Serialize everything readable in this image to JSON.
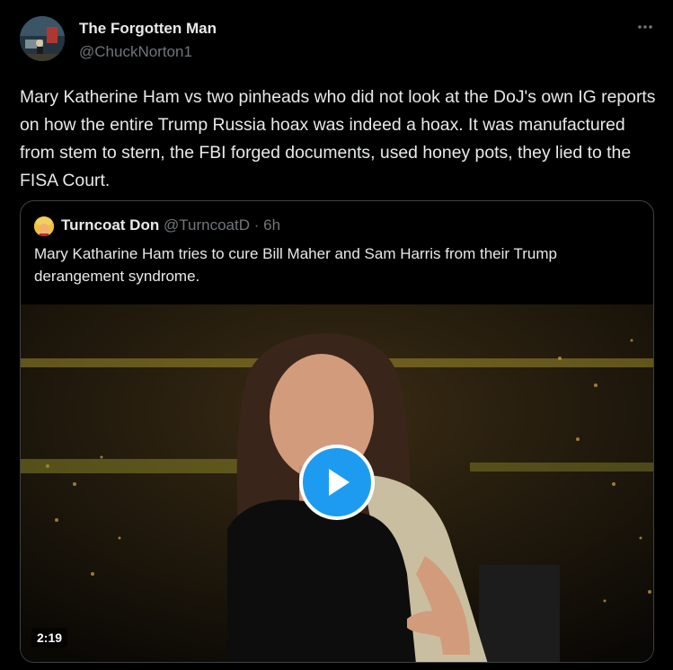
{
  "tweet": {
    "author": {
      "display_name": "The Forgotten Man",
      "handle": "@ChuckNorton1"
    },
    "more_icon": "more-horizontal-icon",
    "text": "Mary Katherine Ham vs two pinheads who did not look at the DoJ's own IG reports on how the entire Trump Russia hoax was indeed a hoax. It was manufactured from stem to stern, the FBI forged documents, used honey pots, they lied to the FISA Court."
  },
  "quote": {
    "author": {
      "display_name": "Turncoat Don",
      "handle": "@TurncoatD",
      "separator": "·",
      "time": "6h"
    },
    "text": "Mary Katharine Ham tries to cure Bill Maher and Sam Harris from their Trump derangement syndrome.",
    "video": {
      "duration": "2:19",
      "play_icon": "play-icon"
    }
  },
  "colors": {
    "accent": "#1d9bf0",
    "background": "#000000",
    "text": "#e7e9ea",
    "muted": "#71767b",
    "border": "#3e4144"
  }
}
